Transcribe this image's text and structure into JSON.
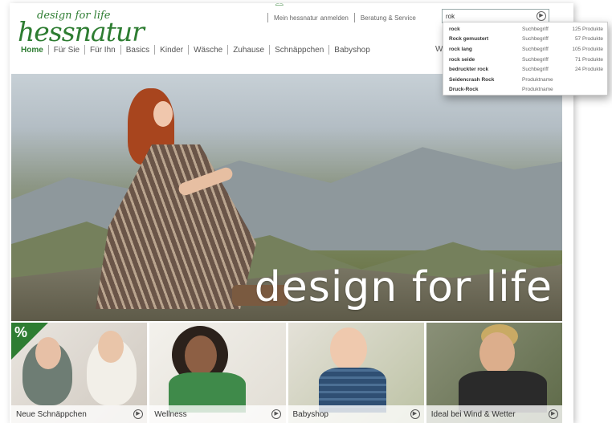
{
  "brand": {
    "tagline": "design for life",
    "name": "hessnatur"
  },
  "topbar": {
    "account_label": "Mein hessnatur",
    "login_label": "anmelden",
    "service_label": "Beratung & Service"
  },
  "search": {
    "value": "rok",
    "button_icon": "search-arrow-icon"
  },
  "nav": {
    "items": [
      {
        "label": "Home",
        "active": true
      },
      {
        "label": "Für Sie"
      },
      {
        "label": "Für Ihn"
      },
      {
        "label": "Basics"
      },
      {
        "label": "Kinder"
      },
      {
        "label": "Wäsche"
      },
      {
        "label": "Zuhause"
      },
      {
        "label": "Schnäppchen"
      },
      {
        "label": "Babyshop"
      }
    ],
    "partial_text": "W"
  },
  "autocomplete": {
    "rows": [
      {
        "term": "rock",
        "type": "Suchbegriff",
        "count": "125 Produkte"
      },
      {
        "term": "Rock gemustert",
        "type": "Suchbegriff",
        "count": "57 Produkte"
      },
      {
        "term": "rock lang",
        "type": "Suchbegriff",
        "count": "105 Produkte"
      },
      {
        "term": "rock seide",
        "type": "Suchbegriff",
        "count": "71 Produkte"
      },
      {
        "term": "bedruckter rock",
        "type": "Suchbegriff",
        "count": "24 Produkte"
      },
      {
        "term": "Seidencrash Rock",
        "type": "Produktname",
        "count": ""
      },
      {
        "term": "Druck-Rock",
        "type": "Produktname",
        "count": ""
      }
    ]
  },
  "hero": {
    "headline": "design for life"
  },
  "tiles": [
    {
      "label": "Neue Schnäppchen",
      "badge": "%"
    },
    {
      "label": "Wellness"
    },
    {
      "label": "Babyshop"
    },
    {
      "label": "Ideal bei Wind & Wetter"
    }
  ],
  "colors": {
    "brand_green": "#2e7d32"
  }
}
